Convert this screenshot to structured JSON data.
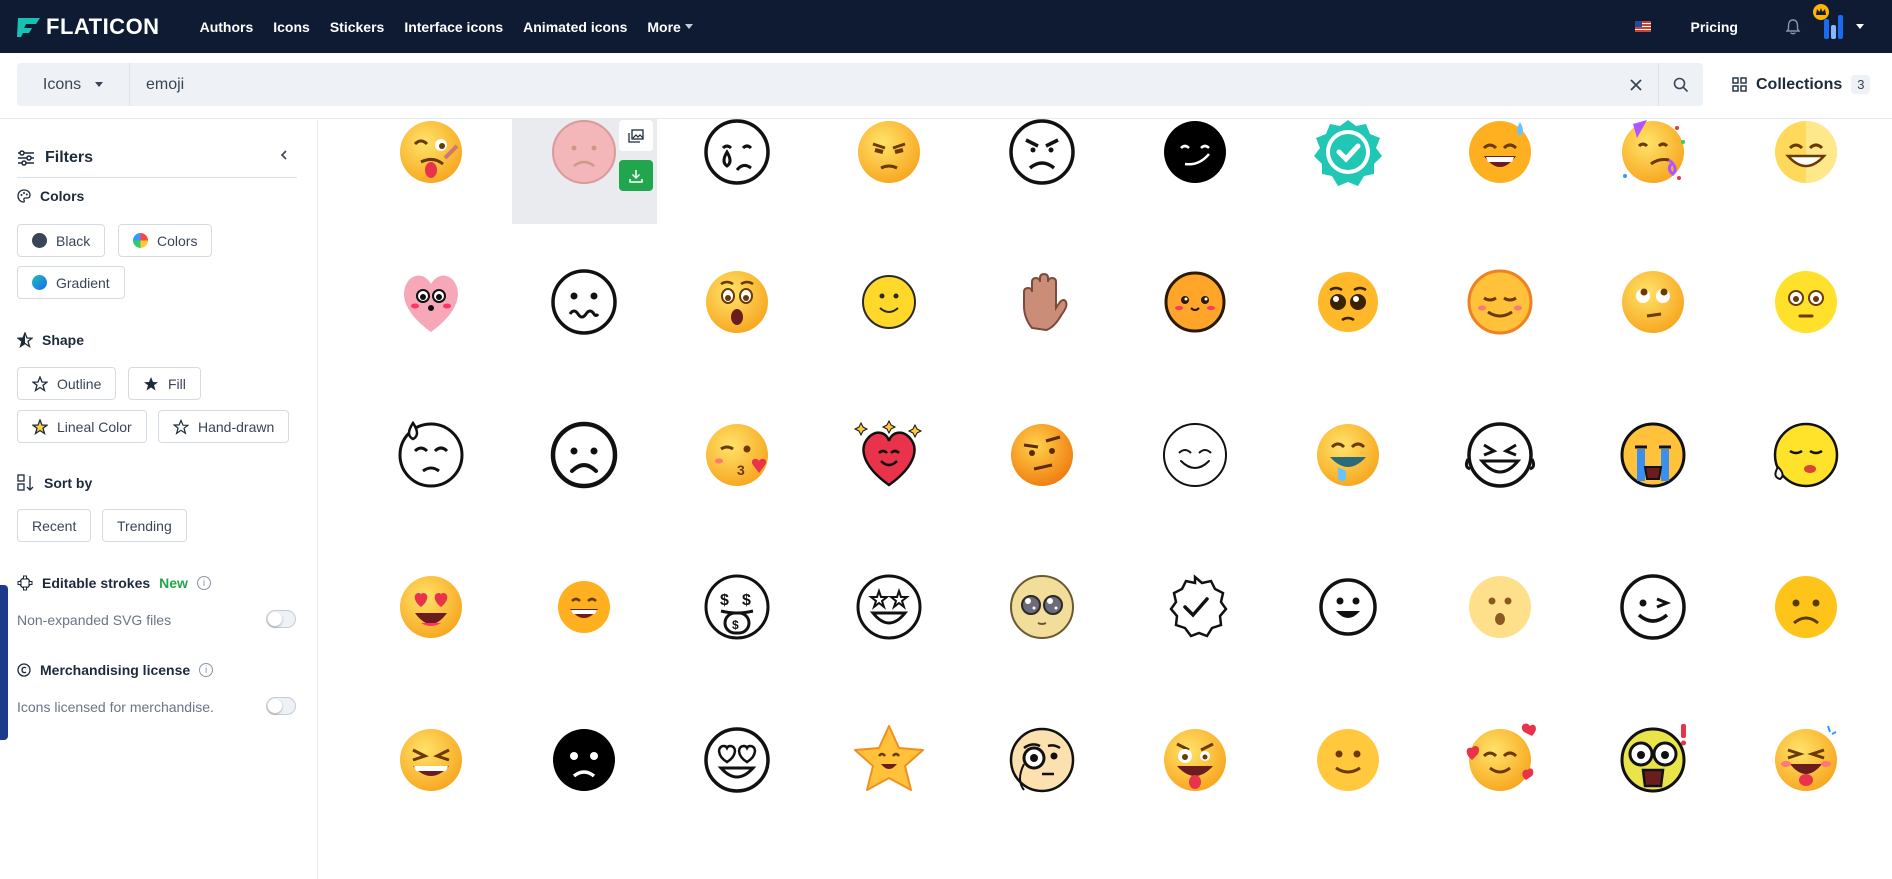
{
  "header": {
    "logo_text": "FLATICON",
    "nav": [
      "Authors",
      "Icons",
      "Stickers",
      "Interface icons",
      "Animated icons"
    ],
    "more_label": "More",
    "pricing_label": "Pricing"
  },
  "search": {
    "type_label": "Icons",
    "query": "emoji",
    "collections_label": "Collections",
    "collections_count": "3"
  },
  "sidebar": {
    "title": "Filters",
    "colors": {
      "title": "Colors",
      "options": [
        "Black",
        "Colors",
        "Gradient"
      ]
    },
    "shape": {
      "title": "Shape",
      "options": [
        "Outline",
        "Fill",
        "Lineal Color",
        "Hand-drawn"
      ]
    },
    "sort": {
      "title": "Sort by",
      "options": [
        "Recent",
        "Trending"
      ]
    },
    "editable": {
      "title": "Editable strokes",
      "badge": "New",
      "sub": "Non-expanded SVG files"
    },
    "merch": {
      "title": "Merchandising license",
      "sub": "Icons licensed for merchandise."
    }
  },
  "icons": [
    [
      "drunk-emoji",
      "sad-emoji-hovered",
      "crying-emoji-outline",
      "bored-emoji",
      "angry-emoji-outline",
      "smirk-emoji-black",
      "verified-badge",
      "sweat-smile-emoji",
      "party-emoji",
      "grin-emoji-half"
    ],
    [
      "heart-face-emoji",
      "wavy-mouth-emoji-outline",
      "surprised-emoji",
      "smile-emoji",
      "raised-hand-emoji",
      "cute-emoji",
      "pleading-emoji",
      "relieved-emoji",
      "rolling-eyes-emoji",
      "neutral-emoji"
    ],
    [
      "sweat-emoji-outline",
      "sad-emoji-outline",
      "kiss-wink-emoji",
      "heart-stars-emoji",
      "suspicious-emoji",
      "happy-emoji-outline",
      "drooling-emoji",
      "laughing-emoji-outline",
      "loud-crying-emoji",
      "sleepy-emoji"
    ],
    [
      "heart-eyes-emoji",
      "grinning-emoji",
      "money-mouth-emoji-outline",
      "star-eyes-emoji-outline",
      "sparkle-eyes-emoji",
      "verified-check-outline",
      "smile-emoji-outline",
      "hushed-emoji",
      "wink-emoji-outline",
      "frown-emoji"
    ],
    [
      "squint-grin-emoji",
      "sad-emoji-black",
      "heart-eyes-emoji-outline",
      "star-emoji",
      "monocle-emoji",
      "crazy-emoji",
      "slight-smile-emoji",
      "hearts-emoji",
      "shocked-emoji",
      "tongue-wink-emoji"
    ]
  ],
  "colors": {
    "nav_bg": "#0f1b33",
    "download_green": "#21a64e",
    "accent_blue": "#1b6bf0"
  }
}
